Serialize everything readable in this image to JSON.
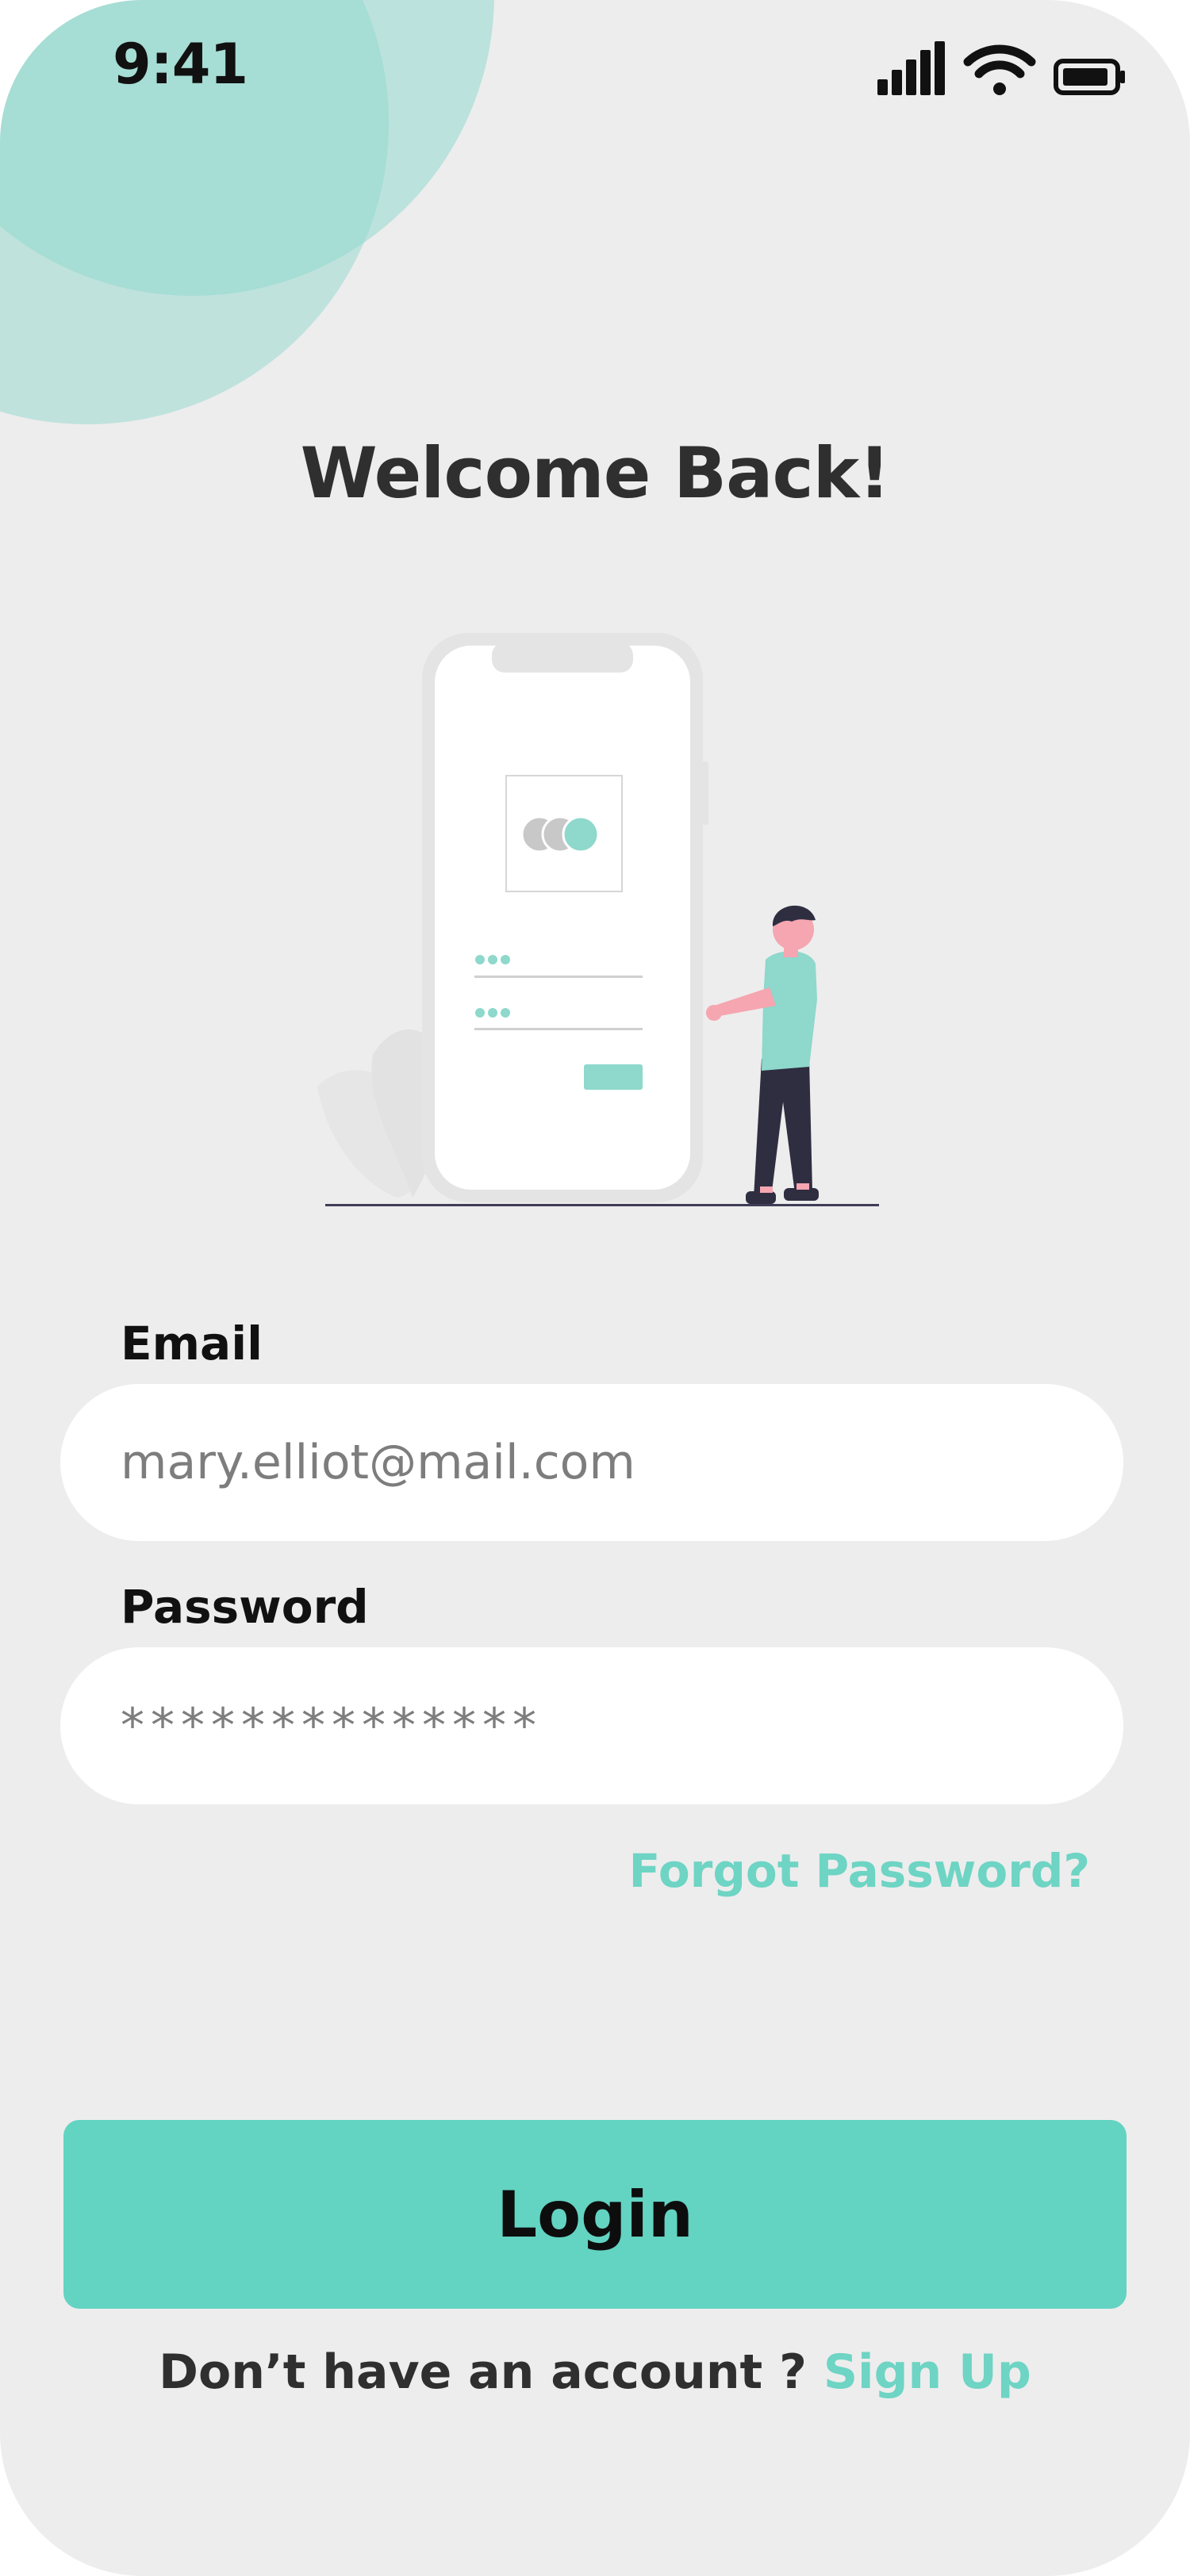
{
  "status_bar": {
    "time": "9:41",
    "signal_icon": "cellular-signal-icon",
    "wifi_icon": "wifi-icon",
    "battery_icon": "battery-icon"
  },
  "header": {
    "title": "Welcome Back!"
  },
  "illustration": {
    "name": "person-with-phone-login-illustration"
  },
  "form": {
    "email_label": "Email",
    "email_value": "mary.elliot@mail.com",
    "password_label": "Password",
    "password_value": "**************",
    "forgot_password": "Forgot Password?"
  },
  "actions": {
    "login_label": "Login",
    "signup_prompt": "Don’t have an account ?",
    "signup_link": "Sign Up"
  },
  "colors": {
    "accent": "#63d3c2",
    "accent_text": "#6ed4c4",
    "background": "#ededed",
    "title": "#2f2f2f"
  }
}
